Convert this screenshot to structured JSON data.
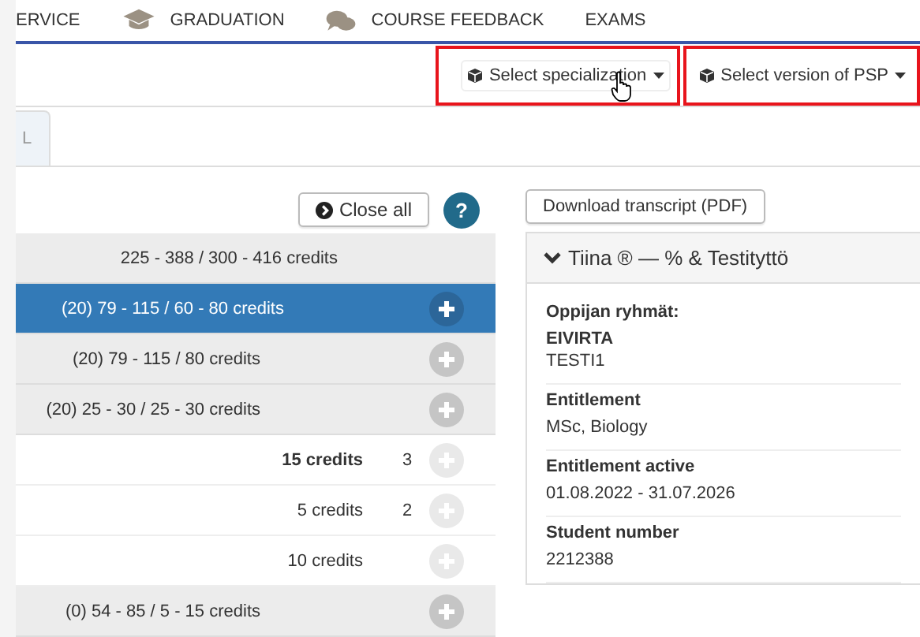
{
  "nav": {
    "items": [
      {
        "label": "ERVICE",
        "kind": "plain"
      },
      {
        "label": "GRADUATION",
        "kind": "graduation"
      },
      {
        "label": "COURSE FEEDBACK",
        "kind": "feedback"
      },
      {
        "label": "EXAMS",
        "kind": "plain"
      }
    ]
  },
  "toolbar": {
    "buttons": [
      {
        "label": "Select specialization",
        "highlighted": true,
        "hovered": true
      },
      {
        "label": "Select version of PSP",
        "highlighted": true,
        "hovered": false
      }
    ]
  },
  "tabs": [
    {
      "label": "L",
      "selected": true
    }
  ],
  "plan": {
    "close_all": "Close all",
    "help": "?",
    "rows": [
      {
        "kind": "header",
        "text": "225 - 388 / 300 - 416 credits",
        "bold": false,
        "count": "",
        "selected": false
      },
      {
        "kind": "group",
        "text": "(20) 79 - 115 / 60 - 80 credits",
        "bold": false,
        "count": "",
        "selected": true
      },
      {
        "kind": "group",
        "text": "(20) 79 - 115 / 80 credits",
        "bold": false,
        "count": "",
        "selected": false
      },
      {
        "kind": "group",
        "text": "(20) 25 - 30 / 25 - 30 credits",
        "bold": false,
        "count": "",
        "selected": false
      },
      {
        "kind": "course",
        "text": "15 credits",
        "bold": true,
        "count": "3",
        "selected": false
      },
      {
        "kind": "course",
        "text": "5 credits",
        "bold": false,
        "count": "2",
        "selected": false
      },
      {
        "kind": "course",
        "text": "10 credits",
        "bold": false,
        "count": "",
        "selected": false
      },
      {
        "kind": "group",
        "text": "(0) 54 - 85 / 5 - 15 credits",
        "bold": false,
        "count": "",
        "selected": false
      }
    ]
  },
  "student": {
    "download_button": "Download transcript (PDF)",
    "title": "Tiina ® — % & Testityttö",
    "expanded": true,
    "sections": [
      {
        "label": "Oppijan ryhmät:",
        "values": [
          {
            "text": "EIVIRTA",
            "bold": true
          },
          {
            "text": "TESTI1",
            "bold": false
          }
        ]
      },
      {
        "label": "Entitlement",
        "values": [
          {
            "text": "MSc, Biology",
            "bold": false
          }
        ]
      },
      {
        "label": "Entitlement active",
        "values": [
          {
            "text": "01.08.2022 - 31.07.2026",
            "bold": false
          }
        ]
      },
      {
        "label": "Student number",
        "values": [
          {
            "text": "2212388",
            "bold": false
          }
        ]
      }
    ]
  }
}
